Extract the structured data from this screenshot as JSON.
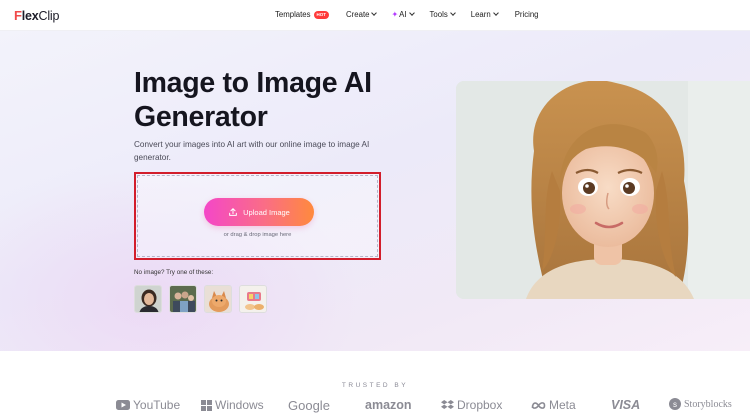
{
  "logo": {
    "f": "F",
    "lex": "lex",
    "clip": "Clip"
  },
  "nav": {
    "templates": "Templates",
    "hot_badge": "HOT",
    "create": "Create",
    "ai": "AI",
    "tools": "Tools",
    "learn": "Learn",
    "pricing": "Pricing"
  },
  "hero": {
    "title_line1": "Image to Image AI",
    "title_line2": "Generator",
    "description": "Convert your images into AI art with our online image to image AI generator.",
    "upload_label": "Upload Image",
    "drag_text": "or drag & drop image here",
    "try_label": "No image? Try one of these:",
    "samples": [
      "sample-woman-portrait",
      "sample-family-photo",
      "sample-cat-photo",
      "sample-objects-photo"
    ]
  },
  "trusted": {
    "label": "TRUSTED BY",
    "brands": [
      "YouTube",
      "Windows",
      "Google",
      "amazon",
      "Dropbox",
      "Meta",
      "VISA",
      "Storyblocks"
    ]
  },
  "colors": {
    "accent_start": "#f447c8",
    "accent_end": "#ff8a3d",
    "highlight_border": "#d21d2b",
    "hot_badge": "#ff3b3b"
  }
}
